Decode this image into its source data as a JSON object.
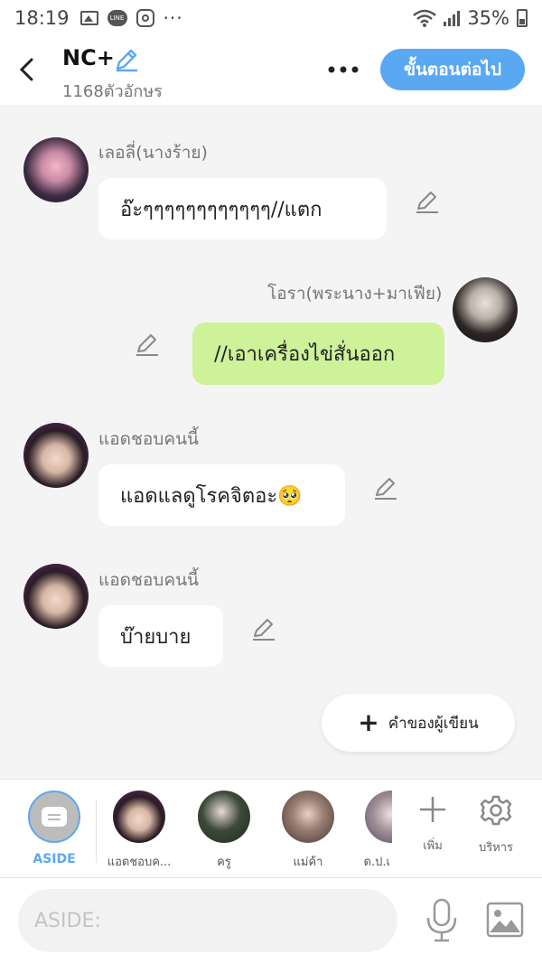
{
  "status_bar": {
    "time": "18:19",
    "line_badge": "LINE",
    "battery": "35%"
  },
  "header": {
    "title": "NC+",
    "char_count": "1168ตัวอักษร",
    "next_button": "ขั้นตอนต่อไป"
  },
  "messages": [
    {
      "sender": "เลอลี่(นางร้าย)",
      "text": "อ๊ะๆๆๆๆๆๆๆๆๆๆๆๆ//แตก",
      "side": "left"
    },
    {
      "sender": "โอรา(พระนาง+มาเฟีย)",
      "text": "//เอาเครื่องไข่สั่นออก",
      "side": "right"
    },
    {
      "sender": "แอดชอบคนนี้",
      "text": "แอดแลดูโรคจิตอะ🥺",
      "side": "left"
    },
    {
      "sender": "แอดชอบคนนี้",
      "text": "บ๊ายบาย",
      "side": "left"
    }
  ],
  "writer_button": {
    "label": "คำของผู้เขียน"
  },
  "characters": [
    {
      "name": "ASIDE",
      "selected": true
    },
    {
      "name": "แอดชอบค..."
    },
    {
      "name": "ครู"
    },
    {
      "name": "แม่ค้า"
    },
    {
      "name": "ด.ป.เ"
    }
  ],
  "tools": {
    "add": "เพิ่ม",
    "manage": "บริหาร"
  },
  "input": {
    "placeholder": "ASIDE:",
    "value": ""
  },
  "colors": {
    "accent": "#5ba8f2",
    "green_bubble": "#cdf29a",
    "background": "#f4f4f4"
  }
}
